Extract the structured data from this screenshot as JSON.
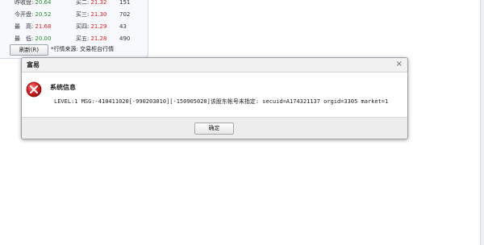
{
  "quote": {
    "left_rows": [
      {
        "label": "昨收盘:",
        "value": "20.64",
        "color": "#2a8c2a"
      },
      {
        "label": "今开盘:",
        "value": "20.52",
        "color": "#2a8c2a"
      },
      {
        "label": "最　高:",
        "value": "21.68",
        "color": "#e02020"
      },
      {
        "label": "最　低:",
        "value": "20.00",
        "color": "#2a8c2a"
      }
    ],
    "right_rows": [
      {
        "label": "买二:",
        "price": "21.32",
        "volume": "151",
        "color": "#e02020"
      },
      {
        "label": "买三:",
        "price": "21.30",
        "volume": "702",
        "color": "#e02020"
      },
      {
        "label": "买四:",
        "price": "21.29",
        "volume": "43",
        "color": "#e02020"
      },
      {
        "label": "买五:",
        "price": "21.28",
        "volume": "490",
        "color": "#e02020"
      }
    ],
    "refresh_label": "刷新(R)",
    "source_note": "*行情来源: 交易柜台行情"
  },
  "dialog": {
    "title": "富易",
    "close_glyph": "×",
    "message_title": "系统信息",
    "message_text": "LEVEL:1 MSG:-410411020[-990203010][-150905020]该股东帐号未指定: secuid=A174321137 orgid=3305 market=1",
    "ok_label": "确定",
    "error_icon": "error-x-icon"
  }
}
